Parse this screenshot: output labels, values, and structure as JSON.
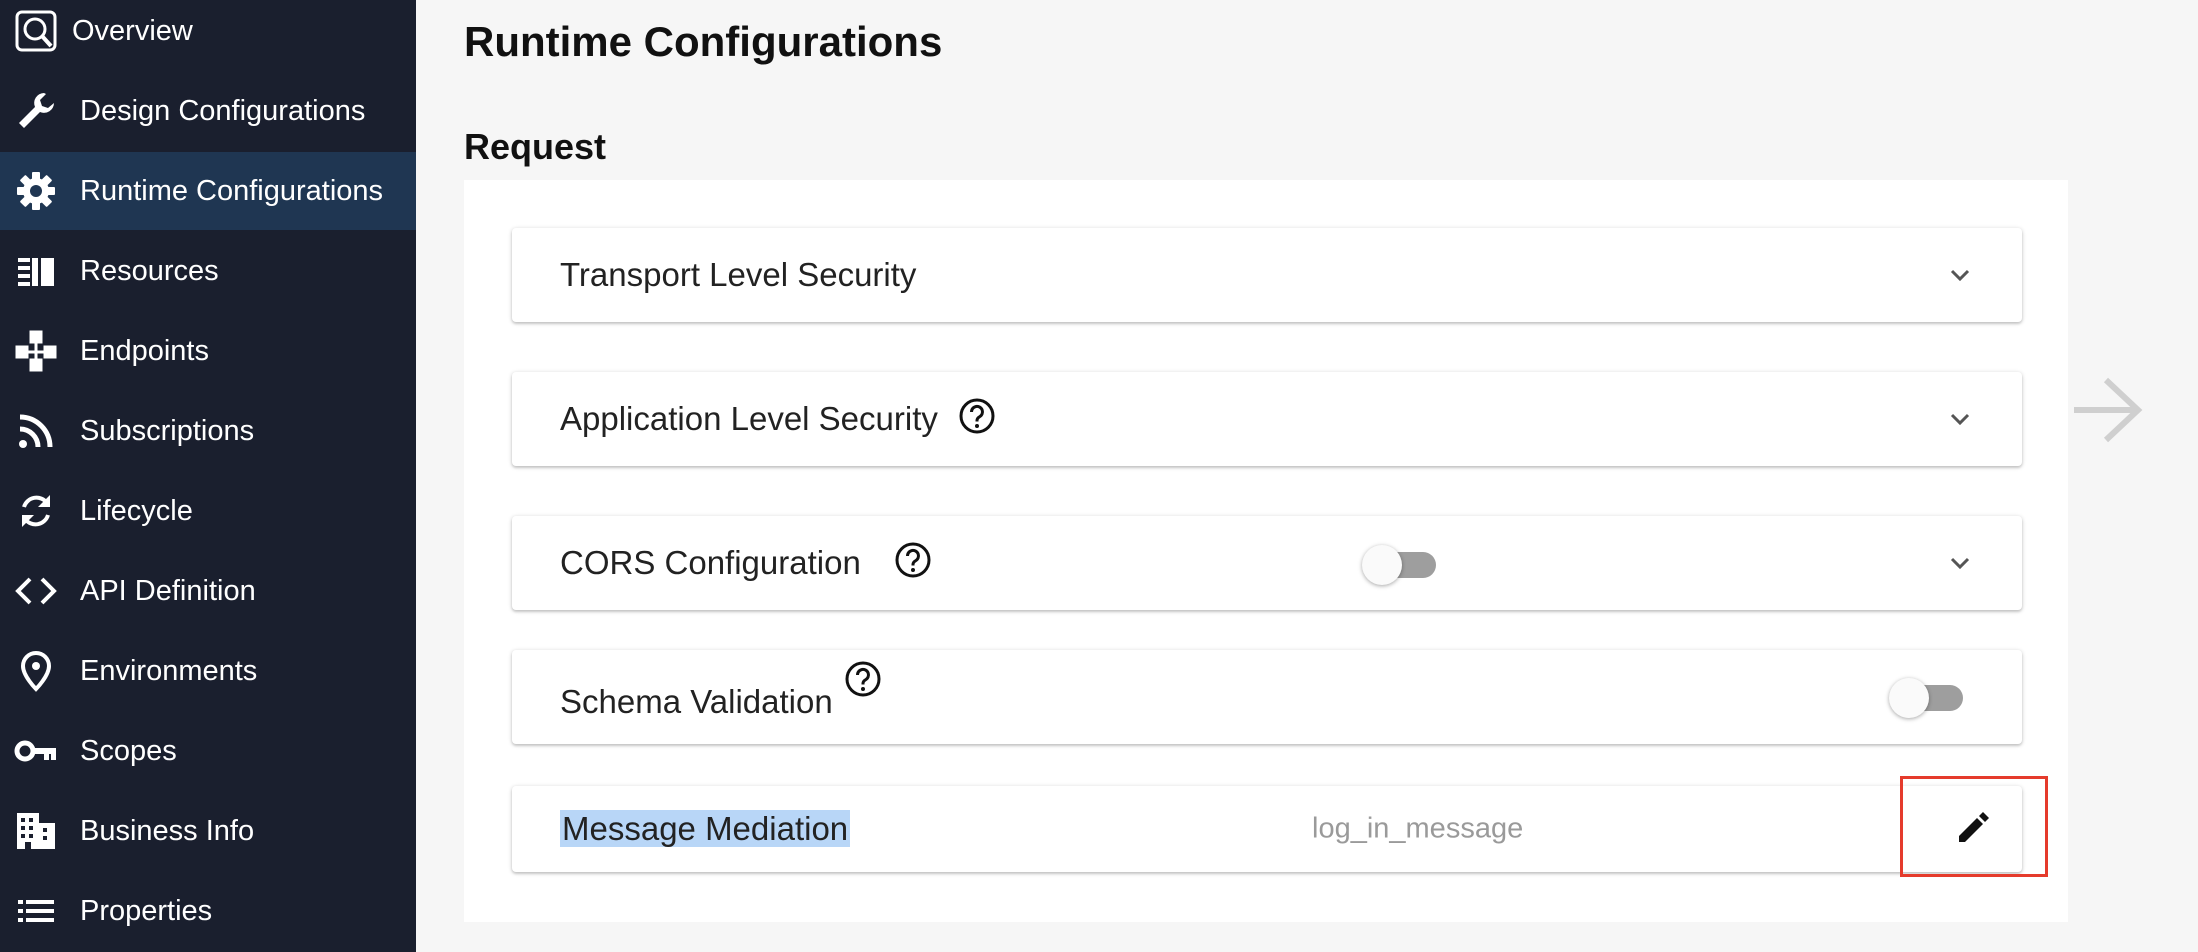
{
  "sidebar": {
    "items": [
      {
        "label": "Overview",
        "icon": "overview-icon",
        "active": false
      },
      {
        "label": "Design Configurations",
        "icon": "wrench-icon",
        "active": false
      },
      {
        "label": "Runtime Configurations",
        "icon": "gear-icon",
        "active": true
      },
      {
        "label": "Resources",
        "icon": "resources-icon",
        "active": false
      },
      {
        "label": "Endpoints",
        "icon": "endpoints-icon",
        "active": false
      },
      {
        "label": "Subscriptions",
        "icon": "rss-icon",
        "active": false
      },
      {
        "label": "Lifecycle",
        "icon": "cycle-icon",
        "active": false
      },
      {
        "label": "API Definition",
        "icon": "code-icon",
        "active": false
      },
      {
        "label": "Environments",
        "icon": "location-pin-icon",
        "active": false
      },
      {
        "label": "Scopes",
        "icon": "key-icon",
        "active": false
      },
      {
        "label": "Business Info",
        "icon": "building-icon",
        "active": false
      },
      {
        "label": "Properties",
        "icon": "list-icon",
        "active": false
      }
    ]
  },
  "main": {
    "title": "Runtime Configurations",
    "section_title": "Request",
    "cards": {
      "transport": {
        "label": "Transport Level Security"
      },
      "application": {
        "label": "Application Level Security"
      },
      "cors": {
        "label": "CORS Configuration",
        "enabled": false
      },
      "schema": {
        "label": "Schema Validation",
        "enabled": false
      },
      "mediation": {
        "label": "Message Mediation",
        "value": "log_in_message"
      }
    }
  },
  "colors": {
    "sidebar_bg": "#1a1f2e",
    "sidebar_active": "#1f3652",
    "highlight": "#b8d6f7",
    "edit_outline": "#e53b2c"
  }
}
